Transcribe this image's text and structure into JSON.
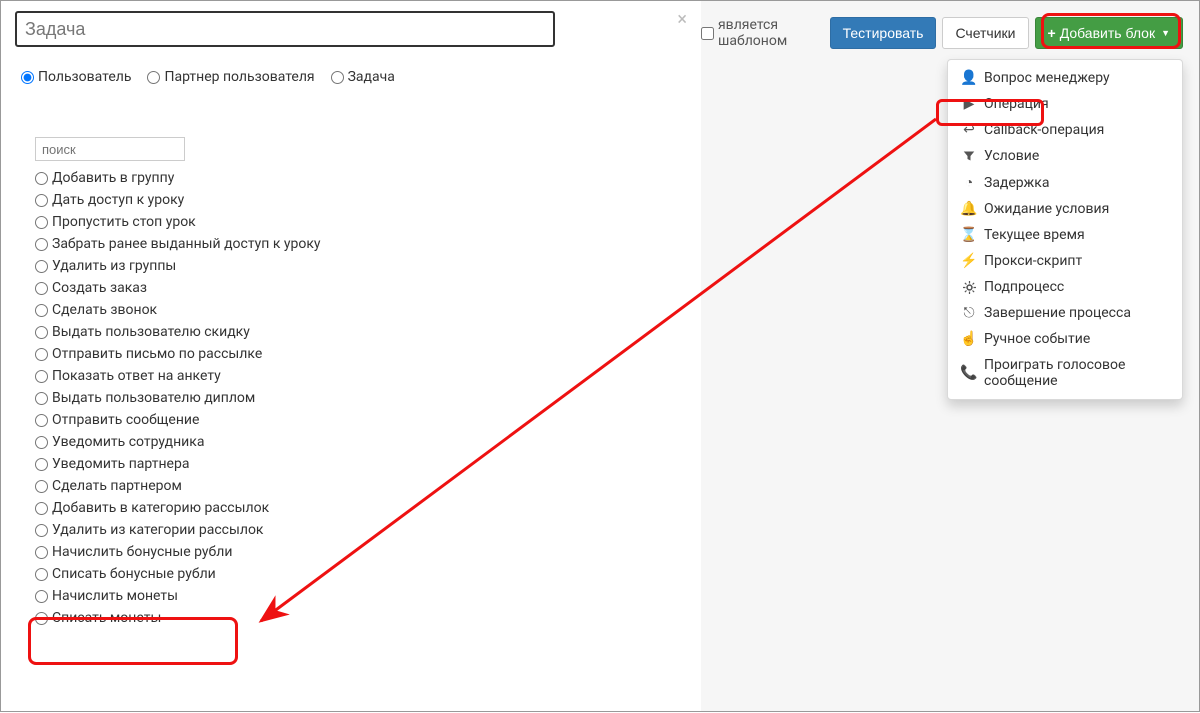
{
  "toolbar": {
    "template_label": "является шаблоном",
    "test_label": "Тестировать",
    "counters_label": "Счетчики",
    "add_block_label": "Добавить блок"
  },
  "dropdown": {
    "items": [
      {
        "icon": "user",
        "label": "Вопрос менеджеру"
      },
      {
        "icon": "play",
        "label": "Операция"
      },
      {
        "icon": "reply",
        "label": "Callback-операция"
      },
      {
        "icon": "filter",
        "label": "Условие"
      },
      {
        "icon": "clock",
        "label": "Задержка"
      },
      {
        "icon": "bell",
        "label": "Ожидание условия"
      },
      {
        "icon": "hourglass",
        "label": "Текущее время"
      },
      {
        "icon": "bolt",
        "label": "Прокси-скрипт"
      },
      {
        "icon": "cog",
        "label": "Подпроцесс"
      },
      {
        "icon": "exit",
        "label": "Завершение процесса"
      },
      {
        "icon": "hand",
        "label": "Ручное событие"
      },
      {
        "icon": "phone",
        "label": "Проиграть голосовое сообщение"
      }
    ]
  },
  "modal": {
    "task_value": "Задача",
    "tabs": {
      "user": "Пользователь",
      "partner": "Партнер пользователя",
      "task": "Задача"
    },
    "search_placeholder": "поиск",
    "operations": [
      "Добавить в группу",
      "Дать доступ к уроку",
      "Пропустить стоп урок",
      "Забрать ранее выданный доступ к уроку",
      "Удалить из группы",
      "Создать заказ",
      "Сделать звонок",
      "Выдать пользователю скидку",
      "Отправить письмо по рассылке",
      "Показать ответ на анкету",
      "Выдать пользователю диплом",
      "Отправить сообщение",
      "Уведомить сотрудника",
      "Уведомить партнера",
      "Сделать партнером",
      "Добавить в категорию рассылок",
      "Удалить из категории рассылок",
      "Начислить бонусные рубли",
      "Списать бонусные рубли",
      "Начислить монеты",
      "Списать монеты"
    ]
  }
}
